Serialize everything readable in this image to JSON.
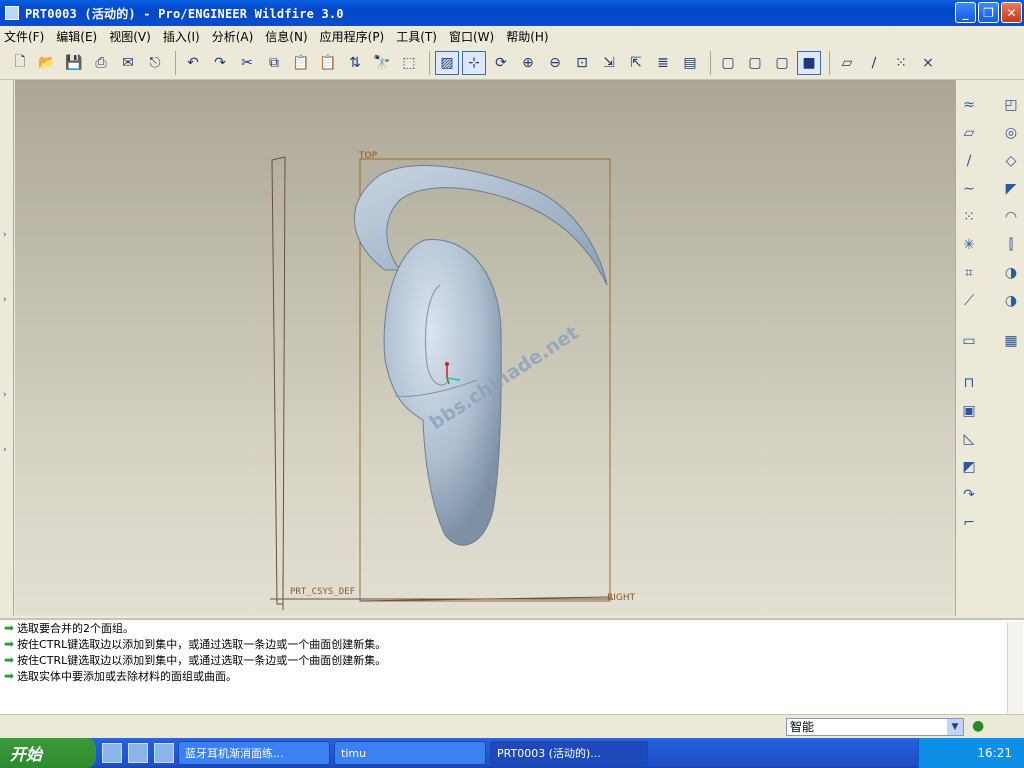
{
  "window": {
    "title": "PRT0003 (活动的) - Pro/ENGINEER Wildfire 3.0"
  },
  "menubar": {
    "items": [
      "文件(F)",
      "编辑(E)",
      "视图(V)",
      "插入(I)",
      "分析(A)",
      "信息(N)",
      "应用程序(P)",
      "工具(T)",
      "窗口(W)",
      "帮助(H)"
    ]
  },
  "viewport": {
    "datum_top": "TOP",
    "datum_right": "RIGHT",
    "csys": "PRT_CSYS_DEF",
    "watermark": "bbs.chinade.net"
  },
  "messages": [
    "选取要合并的2个面组。",
    "按住CTRL键选取边以添加到集中，或通过选取一条边或一个曲面创建新集。",
    "按住CTRL键选取边以添加到集中，或通过选取一条边或一个曲面创建新集。",
    "选取实体中要添加或去除材料的面组或曲面。"
  ],
  "statusbar": {
    "filter_value": "智能"
  },
  "taskbar": {
    "start_label": "开始",
    "items": [
      "蓝牙耳机渐消面练...",
      "timu",
      "PRT0003 (活动的)..."
    ],
    "clock": "16:21"
  }
}
